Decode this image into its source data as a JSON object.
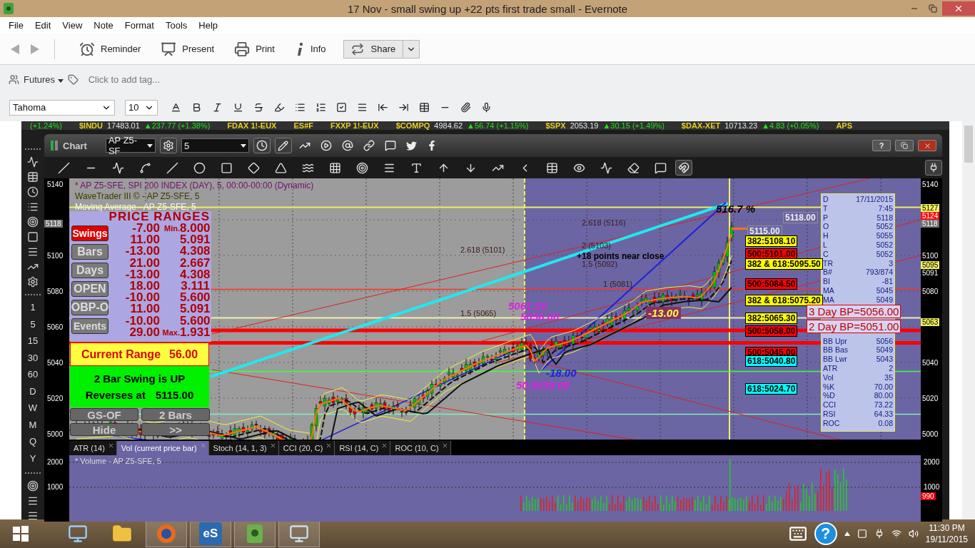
{
  "window": {
    "title": "17 Nov - small swing up +22 pts first trade small - Evernote"
  },
  "menu": [
    "File",
    "Edit",
    "View",
    "Note",
    "Format",
    "Tools",
    "Help"
  ],
  "toolbar": {
    "reminder": "Reminder",
    "present": "Present",
    "print": "Print",
    "info": "Info",
    "share": "Share"
  },
  "tags": {
    "notebook": "Futures",
    "placeholder": "Click to add tag..."
  },
  "format_bar": {
    "font": "Tahoma",
    "size": "10"
  },
  "ticker": [
    {
      "text": "(+1.24%)",
      "kind": "change"
    },
    {
      "text": "$INDU",
      "kind": "symbol"
    },
    {
      "text": "17483.01",
      "kind": "price"
    },
    {
      "text": "▲237.77 (+1.38%)",
      "kind": "change"
    },
    {
      "text": "FDAX 1!-EUX",
      "kind": "symbol"
    },
    {
      "text": "ES#F",
      "kind": "symbol"
    },
    {
      "text": "FXXP 1!-EUX",
      "kind": "symbol"
    },
    {
      "text": "$COMPQ",
      "kind": "symbol"
    },
    {
      "text": "4984.62",
      "kind": "price"
    },
    {
      "text": "▲56.74 (+1.15%)",
      "kind": "change"
    },
    {
      "text": "$SPX",
      "kind": "symbol"
    },
    {
      "text": "2053.19",
      "kind": "price"
    },
    {
      "text": "▲30.15 (+1.49%)",
      "kind": "change"
    },
    {
      "text": "$DAX-XET",
      "kind": "symbol"
    },
    {
      "text": "10713.23",
      "kind": "price"
    },
    {
      "text": "▲4.83 (+0.05%)",
      "kind": "change"
    },
    {
      "text": "APS",
      "kind": "symbol"
    }
  ],
  "timeframes": [
    "1",
    "5",
    "15",
    "30",
    "60",
    "D",
    "W",
    "M",
    "Q",
    "Y"
  ],
  "chart_window": {
    "title": "Chart",
    "symbol": "AP Z5-SF",
    "interval": "5",
    "help": "?"
  },
  "left_axis": [
    {
      "label": "5140"
    },
    {
      "label": "5118",
      "color": "#707070"
    },
    {
      "label": "5100"
    },
    {
      "label": "5080"
    },
    {
      "label": "5060"
    },
    {
      "label": "5040"
    },
    {
      "label": "5020"
    },
    {
      "label": "5000"
    }
  ],
  "right_axis": [
    {
      "label": "5140"
    },
    {
      "label": "5127",
      "color": "#f0f060"
    },
    {
      "label": "5124",
      "color": "#ff1010"
    },
    {
      "label": "5118",
      "color": "#707070"
    },
    {
      "label": "5100"
    },
    {
      "label": "5095",
      "color": "#f0f060"
    },
    {
      "label": "5091"
    },
    {
      "label": "5080"
    },
    {
      "label": "5063",
      "color": "#f0f060"
    },
    {
      "label": "5040"
    },
    {
      "label": "5020"
    },
    {
      "label": "5000"
    }
  ],
  "legend": [
    {
      "text": "* AP Z5-SFE, SPI 200 INDEX (DAY), 5, 00:00-00:00 (Dynamic)",
      "color": "#701070"
    },
    {
      "text": "WaveTrader III © - AP Z5-SFE, 5",
      "color": "#3c3c00"
    },
    {
      "text": "Moving Average - AP Z5-SFE, 5",
      "color": "#f8f8f8"
    }
  ],
  "ranges": {
    "title": "PRICE RANGES",
    "min_label": "Min.",
    "max_label": "Max.",
    "buttons": [
      {
        "label": "Swings",
        "selected": true
      },
      {
        "label": "Bars",
        "selected": false
      },
      {
        "label": "Days",
        "selected": false
      },
      {
        "label": "OPEN",
        "selected": false
      },
      {
        "label": "OBP-O",
        "selected": false
      },
      {
        "label": "Events",
        "selected": false
      }
    ],
    "rows": [
      {
        "size": "-7.00",
        "ratio": "8.000"
      },
      {
        "size": "11.00",
        "ratio": "5.091"
      },
      {
        "size": "-13.00",
        "ratio": "4.308"
      },
      {
        "size": "21.00",
        "ratio": "2.667"
      },
      {
        "size": "-13.00",
        "ratio": "4.308"
      },
      {
        "size": "18.00",
        "ratio": "3.111"
      },
      {
        "size": "-10.00",
        "ratio": "5.600"
      },
      {
        "size": "11.00",
        "ratio": "5.091"
      },
      {
        "size": "-10.00",
        "ratio": "5.600"
      },
      {
        "size": "29.00",
        "ratio": "1.931"
      }
    ],
    "current_label": "Current Range",
    "current_value": "56.00",
    "swing_text": "2 Bar Swing is UP",
    "reverse_label": "Reverses at",
    "reverse_value": "5115.00",
    "bottom_buttons": [
      "GS-OF",
      "2 Bars",
      "Hide",
      ">>"
    ]
  },
  "fib_labels": [
    "2.618 (5101)",
    "1.5 (5065)",
    "2.618 (5116)",
    "2 (5103)",
    "1.5 (5092)",
    "1 (5081)"
  ],
  "annotations": {
    "note": "+18 points near close",
    "swing": "-13.00",
    "percent": "516.7 %",
    "high_a": "5061.00",
    "high_b": "5056.00",
    "low_a": "-18.00",
    "low_b": "50.5038.00"
  },
  "levels": [
    {
      "text": "5118.00",
      "color": "#909090"
    },
    {
      "text": "5115.00",
      "color": "#909090"
    },
    {
      "text": "382:5108.10",
      "color": "#ffff00"
    },
    {
      "text": "500:5101.00",
      "color": "#ff0000"
    },
    {
      "text": "382 & 618:5095.50",
      "color": "#ffff00"
    },
    {
      "text": "500:5084.50",
      "color": "#ff0000"
    },
    {
      "text": "382 & 618:5075.20",
      "color": "#ffff00"
    },
    {
      "text": "382:5065.30",
      "color": "#ffff00"
    },
    {
      "text": "500:5058.00",
      "color": "#ff0000"
    },
    {
      "text": "500:5045.00",
      "color": "#ff0000"
    },
    {
      "text": "618:5040.80",
      "color": "#00ffff"
    },
    {
      "text": "618:5024.70",
      "color": "#00ffff"
    }
  ],
  "day_bp": [
    "3 Day BP=5056.00",
    "2 Day BP=5051.00"
  ],
  "info": [
    {
      "label": "D",
      "value": "17/11/2015"
    },
    {
      "label": "T",
      "value": "7:45"
    },
    {
      "label": "P",
      "value": "5118"
    },
    {
      "label": "O",
      "value": "5052"
    },
    {
      "label": "H",
      "value": "5055"
    },
    {
      "label": "L",
      "value": "5052"
    },
    {
      "label": "C",
      "value": "5052"
    },
    {
      "label": "TR",
      "value": "3"
    },
    {
      "label": "B#",
      "value": "793/874"
    },
    {
      "label": "BI",
      "value": "-81"
    },
    {
      "label": "MA",
      "value": "5045"
    },
    {
      "label": "MA",
      "value": "5049"
    },
    {
      "label": "BB Upr",
      "value": "5056"
    },
    {
      "label": "BB Bas",
      "value": "5049"
    },
    {
      "label": "BB Lwr",
      "value": "5043"
    },
    {
      "label": "ATR",
      "value": "2"
    },
    {
      "label": "Vol",
      "value": "35"
    },
    {
      "label": "%K",
      "value": "70.00"
    },
    {
      "label": "%D",
      "value": "80.00"
    },
    {
      "label": "CCI",
      "value": "73.22"
    },
    {
      "label": "RSI",
      "value": "64.33"
    },
    {
      "label": "ROC",
      "value": "0.08"
    }
  ],
  "indicator_tabs": [
    {
      "label": "ATR (14)",
      "selected": false
    },
    {
      "label": "Vol (current price bar)",
      "selected": true
    },
    {
      "label": "Stoch (14, 1, 3)",
      "selected": false
    },
    {
      "label": "CCI (20, C)",
      "selected": false
    },
    {
      "label": "RSI (14, C)",
      "selected": false
    },
    {
      "label": "ROC (10, C)",
      "selected": false
    }
  ],
  "volume": {
    "legend": "* Volume - AP Z5-SFE, 5",
    "left_axis": [
      "2000",
      "1000"
    ],
    "right_axis": [
      "2000",
      "1000"
    ],
    "last": "990"
  },
  "taskbar": {
    "app_label": "eS",
    "help": "?",
    "time": "11:30 PM",
    "date": "19/11/2015"
  }
}
